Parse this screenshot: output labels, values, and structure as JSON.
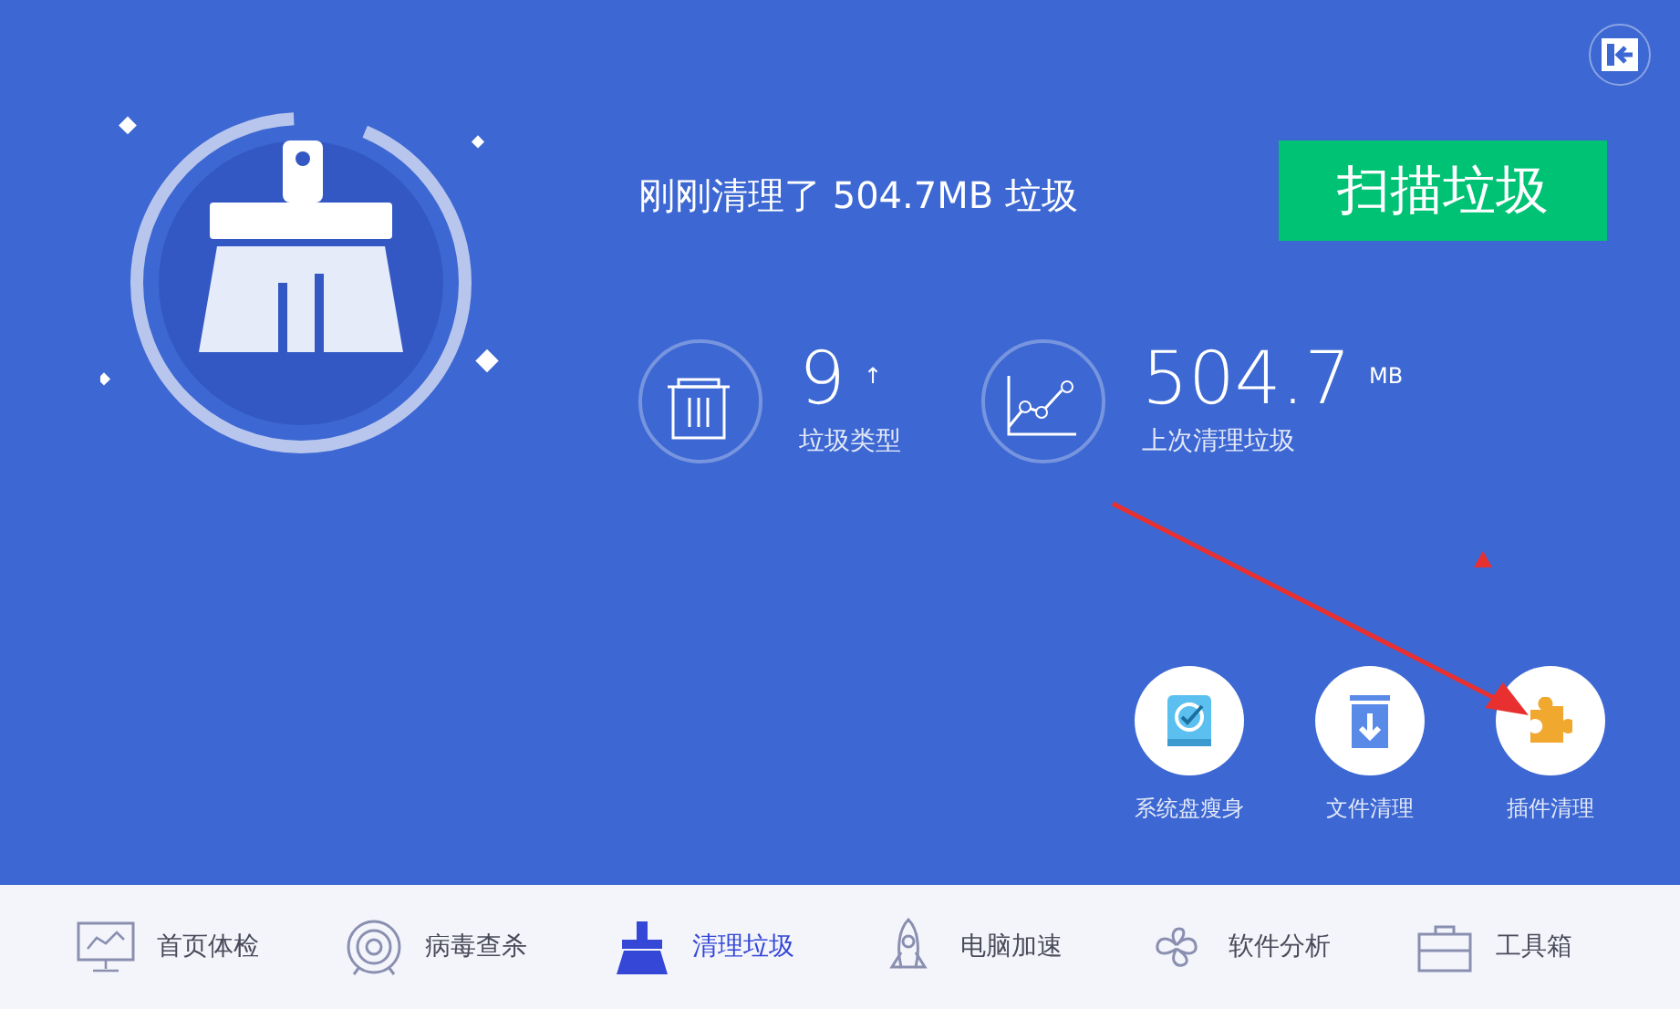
{
  "headline": "刚刚清理了 504.7MB 垃圾",
  "scan_button": "扫描垃圾",
  "stats": [
    {
      "kind": "trash",
      "value": "9",
      "suffix": "↑",
      "label": "垃圾类型"
    },
    {
      "kind": "chart",
      "value": "504.7",
      "suffix": "MB",
      "label": "上次清理垃圾"
    }
  ],
  "tools": [
    {
      "kind": "disk",
      "label": "系统盘瘦身"
    },
    {
      "kind": "file",
      "label": "文件清理"
    },
    {
      "kind": "plugin",
      "label": "插件清理"
    }
  ],
  "nav": [
    {
      "kind": "monitor",
      "label": "首页体检",
      "selected": false
    },
    {
      "kind": "target",
      "label": "病毒查杀",
      "selected": false
    },
    {
      "kind": "broom",
      "label": "清理垃圾",
      "selected": true
    },
    {
      "kind": "rocket",
      "label": "电脑加速",
      "selected": false
    },
    {
      "kind": "clover",
      "label": "软件分析",
      "selected": false
    },
    {
      "kind": "toolbox",
      "label": "工具箱",
      "selected": false
    }
  ]
}
